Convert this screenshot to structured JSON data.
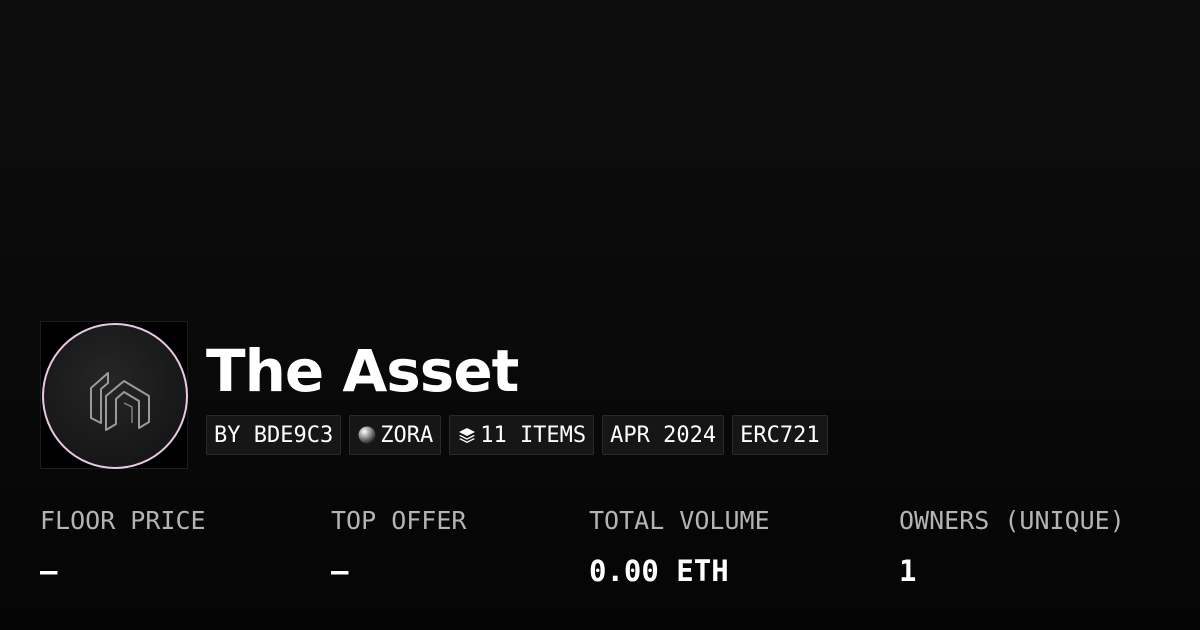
{
  "collection": {
    "name": "The Asset",
    "avatar_icon": "zora-logo-icon"
  },
  "chips": {
    "creator": "BY BDE9C3",
    "network": {
      "icon": "zora-sphere-icon",
      "label": "ZORA"
    },
    "items": {
      "icon": "layers-icon",
      "label": "11 ITEMS"
    },
    "date": "APR 2024",
    "standard": "ERC721"
  },
  "stats": {
    "floor_price": {
      "label": "FLOOR PRICE",
      "value": "–"
    },
    "top_offer": {
      "label": "TOP OFFER",
      "value": "–"
    },
    "total_volume": {
      "label": "TOTAL VOLUME",
      "value": "0.00 ETH"
    },
    "owners": {
      "label": "OWNERS (UNIQUE)",
      "value": "1"
    }
  },
  "colors": {
    "background": "#0a0a0a",
    "chip_background": "#161616",
    "chip_border": "#2a2a2a",
    "avatar_ring": "#e9c9e4",
    "label_gray": "#b4b4b4",
    "text": "#ffffff"
  }
}
